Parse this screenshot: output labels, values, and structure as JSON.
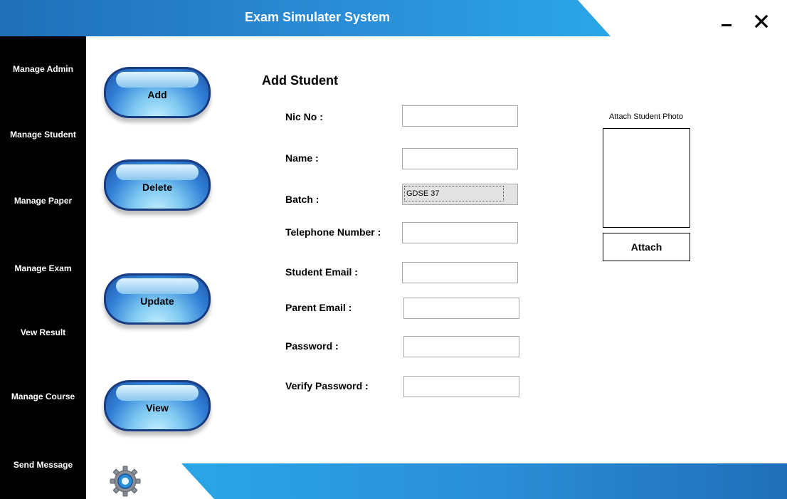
{
  "app": {
    "title": "Exam Simulater System"
  },
  "sidebar": {
    "items": [
      {
        "label": "Manage Admin"
      },
      {
        "label": "Manage Student"
      },
      {
        "label": "Manage Paper"
      },
      {
        "label": "Manage Exam"
      },
      {
        "label": "Vew Result"
      },
      {
        "label": "Manage Course"
      },
      {
        "label": "Send Message"
      }
    ]
  },
  "actions": {
    "add": "Add",
    "delete": "Delete",
    "update": "Update",
    "view": "View"
  },
  "form": {
    "title": "Add Student",
    "nic_label": "Nic No :",
    "name_label": "Name :",
    "batch_label": "Batch :",
    "batch_value": "GDSE 37",
    "telephone_label": "Telephone Number :",
    "student_email_label": "Student Email :",
    "parent_email_label": "Parent Email :",
    "password_label": "Password :",
    "verify_password_label": "Verify Password :"
  },
  "photo": {
    "label": "Attach Student Photo",
    "attach_button": "Attach"
  },
  "icons": {
    "minimize": "minimize-icon",
    "close": "close-icon",
    "settings": "gear-icon"
  },
  "colors": {
    "accent": "#2b8fd8",
    "sidebar": "#000000"
  }
}
